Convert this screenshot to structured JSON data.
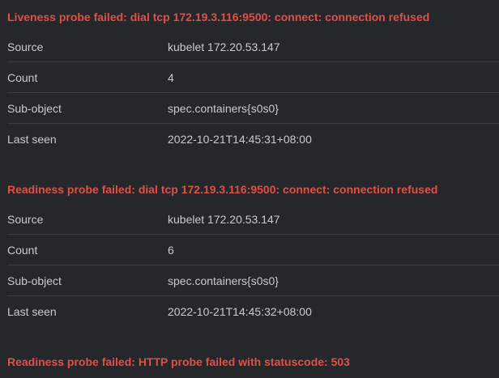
{
  "events": [
    {
      "title": "Liveness probe failed: dial tcp 172.19.3.116:9500: connect: connection refused",
      "rows": [
        {
          "label": "Source",
          "value": "kubelet 172.20.53.147"
        },
        {
          "label": "Count",
          "value": "4"
        },
        {
          "label": "Sub-object",
          "value": "spec.containers{s0s0}"
        },
        {
          "label": "Last seen",
          "value": "2022-10-21T14:45:31+08:00"
        }
      ]
    },
    {
      "title": "Readiness probe failed: dial tcp 172.19.3.116:9500: connect: connection refused",
      "rows": [
        {
          "label": "Source",
          "value": "kubelet 172.20.53.147"
        },
        {
          "label": "Count",
          "value": "6"
        },
        {
          "label": "Sub-object",
          "value": "spec.containers{s0s0}"
        },
        {
          "label": "Last seen",
          "value": "2022-10-21T14:45:32+08:00"
        }
      ]
    },
    {
      "title": "Readiness probe failed: HTTP probe failed with statuscode: 503"
    }
  ]
}
